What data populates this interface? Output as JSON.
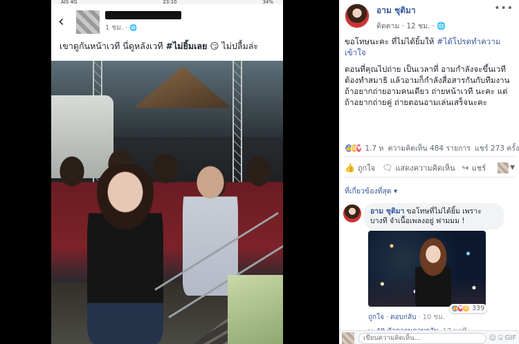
{
  "status_bar": {
    "carrier": "AIS 4G",
    "time": "23:10",
    "battery": "34%"
  },
  "left_post": {
    "time": "1 ชม.",
    "caption_pre": "เขาดูกันหน้าเวที นี่ดูหลังเวที ",
    "caption_bold": "#ไม่ยิ้มเลย",
    "caption_post": " 😏 ไม่ปลื้มล่ะ"
  },
  "fb_post": {
    "author": "อาม ชุติมา",
    "follow": "ติดตาม",
    "time": "12 ชม.",
    "paragraph1_pre": "ขอโทษนะคะ ที่ไม่ได้ยิ้มให้ ",
    "paragraph1_hashtag": "#ได้โปรดทำความเข้าใจ",
    "paragraph2": "ตอนที่คุณไปถ่าย เป็นเวลาที่ อามกำลังจะขึ้นเวที ต้องทำสมาธิ แล้วอามก็กำลังสื่อสารกันกับทีมงาน ถ้าอยากถ่ายอามคนเดียว ถ่ายหน้าเวที นะคะ แต่ถ้าอยากถ่ายคู่ ถ่ายตอนอามเล่นเสร็จนะคะ",
    "reaction_count": "1.7 ห",
    "comments_count": "ความคิดเห็น 484 รายการ",
    "shares_count": "แชร์ 273 ครั้ง",
    "like_label": "ถูกใจ",
    "comment_label": "แสดงความคิดเห็น",
    "share_label": "แชร์",
    "most_relevant": "ที่เกี่ยวข้องที่สุด ▾"
  },
  "comment": {
    "author": "อาม ชุติมา",
    "text": "ขอโทษที่ไม่ได้ยิ้ม เพราะบางที จำเนื้อเพลงอยู่ ฟามมม !",
    "reaction_count": "339",
    "like_label": "ถูกใจ",
    "reply_label": "ตอบกลับ",
    "time": "10 ชม.",
    "replies_label": "↪ 48 ตัวความตอบกลับ",
    "replies_time": "17 นาที"
  },
  "composer": {
    "placeholder": "เขียนความคิดเห็น...",
    "tools": "☺ ⌸ GIF"
  },
  "colors": {
    "link": "#365899",
    "text": "#1d2129",
    "muted": "#616770",
    "like": "#5890ff",
    "haha": "#f7b125",
    "love": "#f25268"
  }
}
